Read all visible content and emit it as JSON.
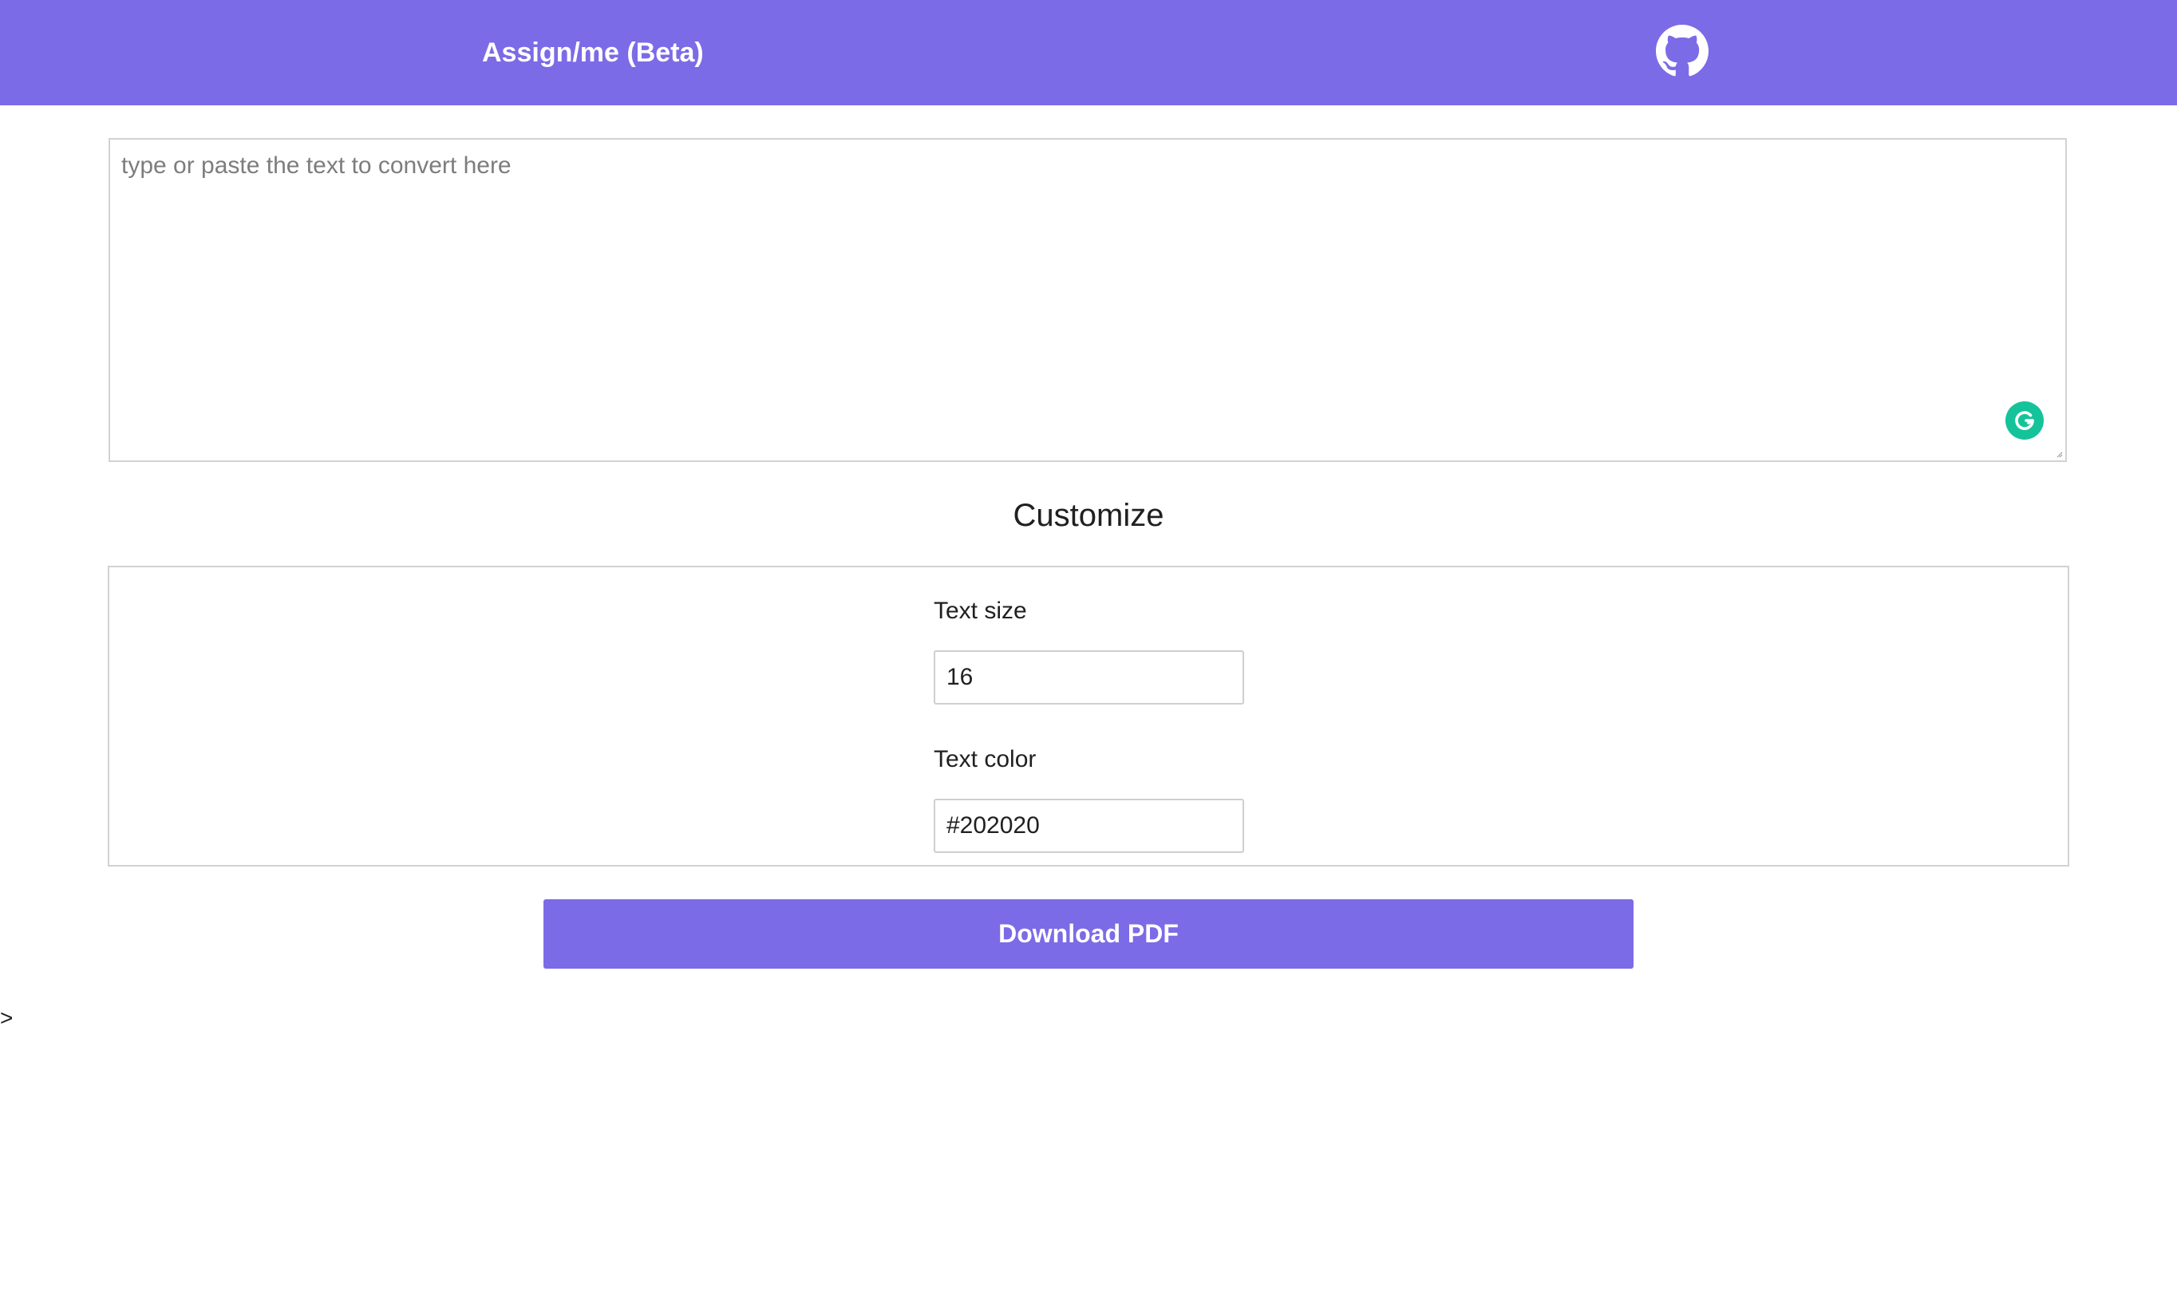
{
  "header": {
    "brand": "Assign/me (Beta)",
    "github_icon": "github-icon",
    "background_color": "#7b6be7"
  },
  "editor": {
    "placeholder": "type or paste the text to convert here",
    "value": "",
    "assistant_icon": "grammarly-icon"
  },
  "customize": {
    "title": "Customize",
    "text_size": {
      "label": "Text size",
      "value": "16"
    },
    "text_color": {
      "label": "Text color",
      "value": "#202020"
    }
  },
  "actions": {
    "download_label": "Download PDF"
  },
  "stray_text": ">"
}
